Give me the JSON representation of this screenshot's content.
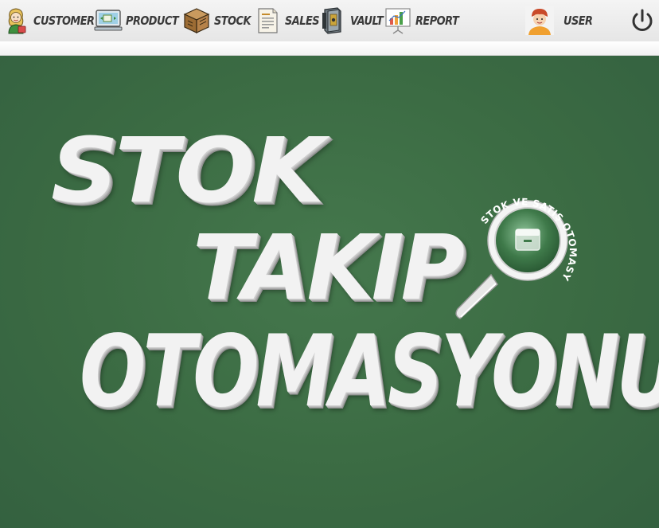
{
  "nav": {
    "items": [
      {
        "label": "CUSTOMER",
        "icon": "customer-icon"
      },
      {
        "label": "PRODUCT",
        "icon": "product-icon"
      },
      {
        "label": "STOCK",
        "icon": "stock-box-icon"
      },
      {
        "label": "SALES",
        "icon": "sales-document-icon"
      },
      {
        "label": "VAULT",
        "icon": "vault-icon"
      },
      {
        "label": "REPORT",
        "icon": "report-chart-icon"
      }
    ],
    "user": {
      "label": "USER",
      "icon": "user-avatar-icon"
    },
    "power_icon": "power-icon"
  },
  "hero": {
    "line1": "STOK",
    "line2": "TAKIP",
    "line3": "OTOMASYONU",
    "badge_text": "STOK VE SATIŞ OTOMASYONU",
    "badge_icon": "magnifier-logo-icon"
  },
  "colors": {
    "background": "#3b6b43",
    "bar": "#eeeeee",
    "text": "#3a3a3a",
    "hero_text": "#f2f2f2"
  }
}
